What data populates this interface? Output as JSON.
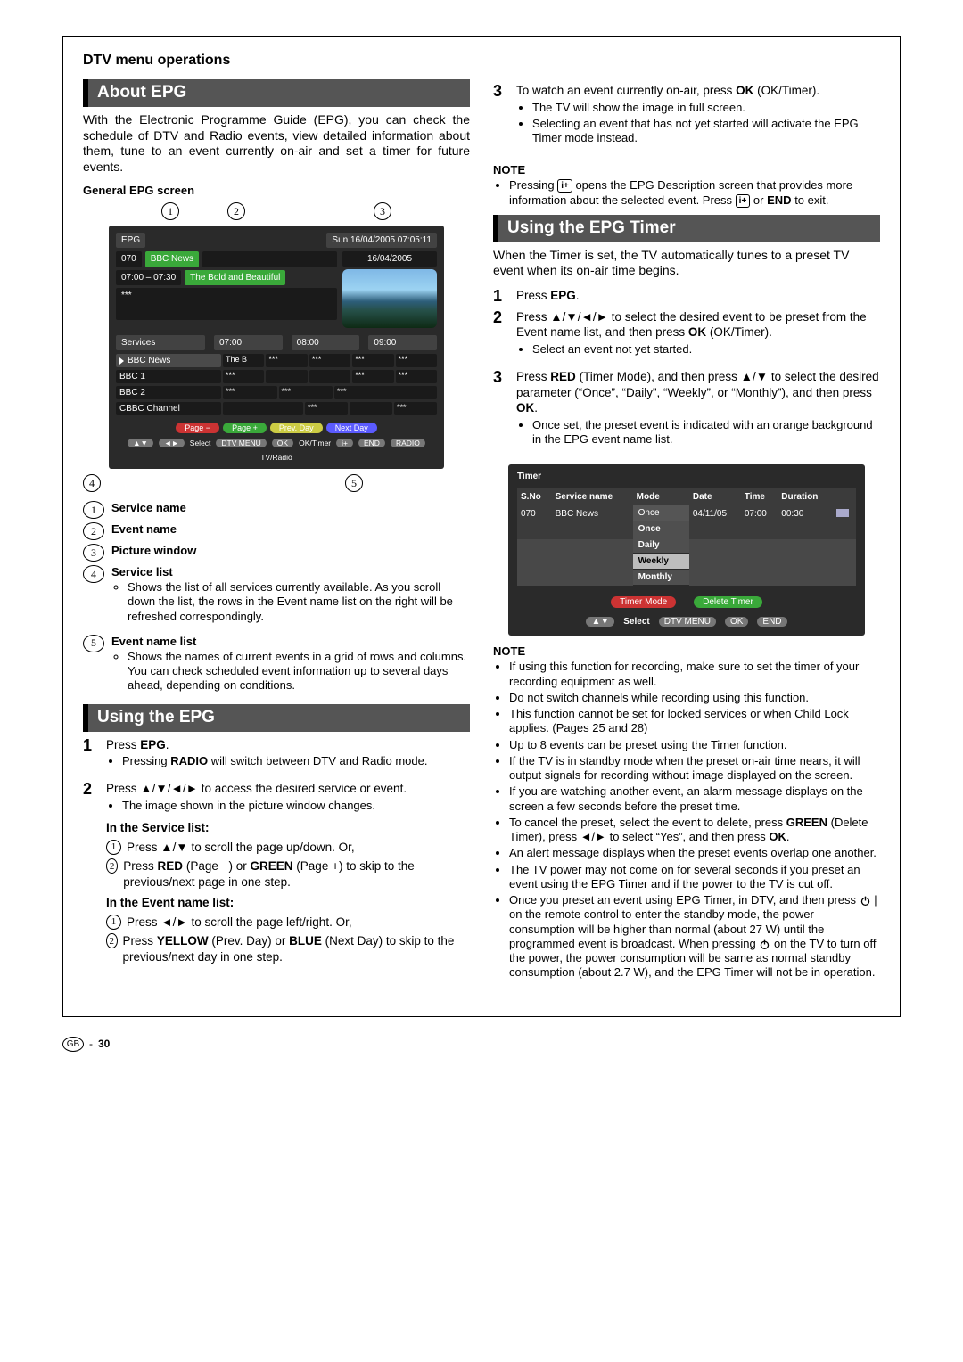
{
  "section_title": "DTV menu operations",
  "about_epg": {
    "heading": "About EPG",
    "intro": "With the Electronic Programme Guide (EPG), you can check the schedule of DTV and Radio events, view detailed information about them, tune to an event currently on-air and set a timer for future events.",
    "general_screen_label": "General EPG screen",
    "callouts_top": [
      "1",
      "2",
      "3"
    ],
    "callouts_bottom": [
      "4",
      "5"
    ],
    "legend": {
      "i1": "Service name",
      "i2": "Event name",
      "i3": "Picture window",
      "i4": "Service list",
      "i4_desc": "Shows the list of all services currently available. As you scroll down the list, the rows in the Event name list on the right will be refreshed correspondingly.",
      "i5": "Event name list",
      "i5_desc": "Shows the names of current events in a grid of rows and columns. You can check scheduled event information up to several days ahead, depending on conditions."
    },
    "screen": {
      "label": "EPG",
      "datetime": "Sun 16/04/2005 07:05:11",
      "channel_no": "070",
      "channel_name": "BBC News",
      "sched_date": "16/04/2005",
      "timeslot": "07:00 – 07:30",
      "event_title": "The Bold and Beautiful",
      "event_more": "***",
      "col_services": "Services",
      "col_h1": "07:00",
      "col_h2": "08:00",
      "col_h3": "09:00",
      "rows": {
        "r1": "BBC News",
        "r1_a": "The B",
        "r2": "BBC 1",
        "r3": "BBC 2",
        "r4": "CBBC Channel"
      },
      "nav": {
        "page_minus": "Page −",
        "page_plus": "Page +",
        "prev_day": "Prev. Day",
        "next_day": "Next Day"
      },
      "hints": {
        "select": "Select",
        "dtv_menu": "DTV MENU",
        "ok": "OK",
        "ok_timer": "OK/Timer",
        "i": "i+",
        "end": "END",
        "radio": "RADIO",
        "tvradio": "TV/Radio"
      }
    }
  },
  "using_epg": {
    "heading": "Using the EPG",
    "s1_a": "Press",
    "s1_b": "EPG",
    "s1_c": ".",
    "s1_bullet": "Pressing RADIO will switch between DTV and Radio mode.",
    "s2": "Press ▲/▼/◄/► to access the desired service or event.",
    "s2_bullet": "The image shown in the picture window changes.",
    "service_list_head": "In the Service list:",
    "service_list_1": "Press ▲/▼ to scroll the page up/down. Or,",
    "service_list_2a": "Press",
    "service_list_2b": "RED",
    "service_list_2c": "(Page −) or",
    "service_list_2d": "GREEN",
    "service_list_2e": "(Page +) to skip to the previous/next page in one step.",
    "event_list_head": "In the Event name list:",
    "event_list_1": "Press ◄/► to scroll the page left/right. Or,",
    "event_list_2a": "Press",
    "event_list_2b": "YELLOW",
    "event_list_2c": "(Prev. Day) or",
    "event_list_2d": "BLUE",
    "event_list_2e": "(Next Day) to skip to the previous/next day in one step."
  },
  "step3": {
    "text_a": "To watch an event currently on-air, press",
    "text_b": "OK",
    "text_c": "(OK/Timer).",
    "b1": "The TV will show the image in full screen.",
    "b2": "Selecting an event that has not yet started will activate the EPG Timer mode instead."
  },
  "note1": {
    "head": "NOTE",
    "text_a": "Pressing",
    "text_b": "opens the EPG Description screen that provides more information about the selected event. Press",
    "text_c": "or",
    "text_d": "END",
    "text_e": "to exit."
  },
  "epg_timer": {
    "heading": "Using the EPG Timer",
    "intro": "When the Timer is set, the TV automatically tunes to a preset TV event when its on-air time begins.",
    "s1_a": "Press",
    "s1_b": "EPG",
    "s1_c": ".",
    "s2_a": "Press ▲/▼/◄/► to select the desired event to be preset from the Event name list, and then press",
    "s2_b": "OK",
    "s2_c": "(OK/Timer).",
    "s2_bullet": "Select an event not yet started.",
    "s3_a": "Press",
    "s3_b": "RED",
    "s3_c": "(Timer Mode), and then press ▲/▼ to select the desired parameter (“Once”, “Daily”, “Weekly”, or “Monthly”), and then press",
    "s3_d": "OK",
    "s3_e": ".",
    "s3_bullet": "Once set, the preset event is indicated with an orange background in the EPG event name list.",
    "screen": {
      "title": "Timer",
      "h_sno": "S.No",
      "h_service": "Service name",
      "h_mode": "Mode",
      "h_date": "Date",
      "h_time": "Time",
      "h_duration": "Duration",
      "sno": "070",
      "service": "BBC News",
      "mode1": "Once",
      "mode2": "Daily",
      "mode3": "Weekly",
      "mode4": "Monthly",
      "date": "04/11/05",
      "time": "07:00",
      "duration": "00:30",
      "btn_timer_mode": "Timer Mode",
      "btn_delete": "Delete Timer",
      "hint_select": "Select",
      "hint_dtv": "DTV MENU",
      "hint_ok": "OK",
      "hint_end": "END"
    }
  },
  "note2": {
    "head": "NOTE",
    "b1": "If using this function for recording, make sure to set the timer of your recording equipment as well.",
    "b2": "Do not switch channels while recording using this function.",
    "b3": "This function cannot be set for locked services or when Child Lock applies. (Pages 25 and 28)",
    "b4": "Up to 8 events can be preset using the Timer function.",
    "b5": "If the TV is in standby mode when the preset on-air time nears, it will output signals for recording without image displayed on the screen.",
    "b6": "If you are watching another event, an alarm message displays on the screen a few seconds before the preset time.",
    "b7_a": "To cancel the preset, select the event to delete, press",
    "b7_b": "GREEN",
    "b7_c": "(Delete Timer), press ◄/► to select “Yes”, and then press",
    "b7_d": "OK",
    "b7_e": ".",
    "b8": "An alert message displays when the preset events overlap one another.",
    "b9": "The TV power may not come on for several seconds if you preset an event using the EPG Timer and if the power to the TV is cut off.",
    "b10_a": "Once you preset an event using EPG Timer, in DTV, and then press",
    "b10_b": "on the remote control to enter the standby mode, the power consumption will be higher than normal (about 27 W) until the programmed event is broadcast. When pressing",
    "b10_c": "on the TV to turn off the power, the power consumption will be same as normal standby consumption (about 2.7 W), and the EPG Timer will not be in operation."
  },
  "page_no": {
    "gb": "GB",
    "sep": "-",
    "num": "30"
  }
}
